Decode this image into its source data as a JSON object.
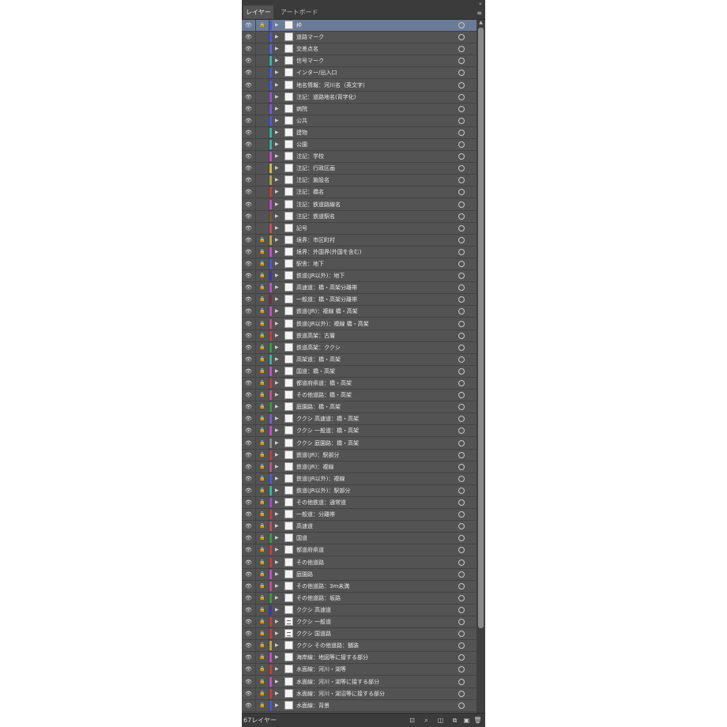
{
  "panel": {
    "tabs": [
      {
        "label": "レイヤー",
        "active": true
      },
      {
        "label": "アートボード",
        "active": false
      }
    ],
    "collapse_icon": "double-chevron-icon",
    "menu_icon": "panel-menu-icon"
  },
  "colors": {
    "panel_bg": "#535353",
    "selected_row": "#6b7a96",
    "tab_bar": "#3b3b3b"
  },
  "layers": [
    {
      "name": "枠",
      "color": "#4a5ad8",
      "locked": true,
      "selected": true
    },
    {
      "name": "道路マーク",
      "color": "#4a5ad8",
      "locked": false
    },
    {
      "name": "交差点名",
      "color": "#5566d8",
      "locked": false
    },
    {
      "name": "信号マーク",
      "color": "#3bb0a8",
      "locked": false
    },
    {
      "name": "インター/出入口",
      "color": "#4a5ad8",
      "locked": false
    },
    {
      "name": "地名情報：河川名（英文字）",
      "color": "#4a5ad8",
      "locked": false
    },
    {
      "name": "注記：道路地名(背字化)",
      "color": "#9a4fd0",
      "locked": false
    },
    {
      "name": "病院",
      "color": "#7a5ad8",
      "locked": false
    },
    {
      "name": "公共",
      "color": "#4a5ad8",
      "locked": false
    },
    {
      "name": "建物",
      "color": "#3bb0a8",
      "locked": false
    },
    {
      "name": "公園",
      "color": "#3bb0a8",
      "locked": false
    },
    {
      "name": "注記：学校",
      "color": "#c04fc8",
      "locked": false
    },
    {
      "name": "注記：行政区画",
      "color": "#c8c040",
      "locked": false
    },
    {
      "name": "注記：施設名",
      "color": "#b0a050",
      "locked": false
    },
    {
      "name": "注記：橋名",
      "color": "#c04040",
      "locked": false
    },
    {
      "name": "注記：鉄道路線名",
      "color": "#c04fc8",
      "locked": false
    },
    {
      "name": "注記：鉄道駅名",
      "color": "#7a5a30",
      "locked": false
    },
    {
      "name": "記号",
      "color": "#c05060",
      "locked": false
    },
    {
      "name": "境界：市区町村",
      "color": "#c0a040",
      "locked": true
    },
    {
      "name": "境界：外国界(外国を含む)",
      "color": "#c04fc8",
      "locked": true
    },
    {
      "name": "駅舎：地下",
      "color": "#4a5ad8",
      "locked": true
    },
    {
      "name": "鉄道(JR以外)：地下",
      "color": "#3a3ab0",
      "locked": true
    },
    {
      "name": "高速道：橋・高架分離帯",
      "color": "#c04fc8",
      "locked": true
    },
    {
      "name": "一般道：橋・高架分離帯",
      "color": "#7a3040",
      "locked": true
    },
    {
      "name": "鉄道(JR)：複線 橋・高架",
      "color": "#c04fc8",
      "locked": true
    },
    {
      "name": "鉄道(JR以外)：複線 橋・高架",
      "color": "#c05090",
      "locked": true
    },
    {
      "name": "鉄道高架：古層",
      "color": "#c04040",
      "locked": true
    },
    {
      "name": "鉄道高架：ククシ",
      "color": "#3a9a40",
      "locked": true
    },
    {
      "name": "高架道：橋・高架",
      "color": "#3bb0a8",
      "locked": true
    },
    {
      "name": "国道：橋・高架",
      "color": "#c04fc8",
      "locked": true
    },
    {
      "name": "都道府県道：橋・高架",
      "color": "#c04040",
      "locked": true
    },
    {
      "name": "その他道路：橋・高架",
      "color": "#c05090",
      "locked": true
    },
    {
      "name": "庭園路：橋・高架",
      "color": "#3a9a40",
      "locked": true
    },
    {
      "name": "ククシ 高速道：橋・高架",
      "color": "#7a5ad8",
      "locked": true
    },
    {
      "name": "ククシ 一般道：橋・高架",
      "color": "#c04fc8",
      "locked": true
    },
    {
      "name": "ククシ 庭園路：橋・高架",
      "color": "#8a8a8a",
      "locked": true
    },
    {
      "name": "鉄道(JR)：駅部分",
      "color": "#c04040",
      "locked": true
    },
    {
      "name": "鉄道(JR)：複線",
      "color": "#c05090",
      "locked": true
    },
    {
      "name": "鉄道(JR以外)：複線",
      "color": "#4a5ad8",
      "locked": true
    },
    {
      "name": "鉄道(JR以外)：駅部分",
      "color": "#3bb0a8",
      "locked": true
    },
    {
      "name": "その他鉄道：通常道",
      "color": "#9a4fd0",
      "locked": true
    },
    {
      "name": "一般道：分離帯",
      "color": "#c04040",
      "locked": true
    },
    {
      "name": "高速道",
      "color": "#c05060",
      "locked": true
    },
    {
      "name": "国道",
      "color": "#3a9a40",
      "locked": true
    },
    {
      "name": "都道府県道",
      "color": "#c04040",
      "locked": true
    },
    {
      "name": "その他道路",
      "color": "#c04040",
      "locked": true
    },
    {
      "name": "庭園路",
      "color": "#c04fc8",
      "locked": true
    },
    {
      "name": "その他道路：3m未満",
      "color": "#c05090",
      "locked": true
    },
    {
      "name": "その他道路：坂路",
      "color": "#3a9a40",
      "locked": true
    },
    {
      "name": "ククシ 高速道",
      "color": "#3a3ab0",
      "locked": true
    },
    {
      "name": "ククシ 一般道",
      "color": "#c04040",
      "locked": true,
      "art": true
    },
    {
      "name": "ククシ 国道路",
      "color": "#c04040",
      "locked": true,
      "art": true
    },
    {
      "name": "ククシ その他道路：舗装",
      "color": "#c0a040",
      "locked": true
    },
    {
      "name": "海岸線：地図等に接する部分",
      "color": "#c04fc8",
      "locked": true
    },
    {
      "name": "水面線：河川・湖等",
      "color": "#c04040",
      "locked": true
    },
    {
      "name": "水面線：河川・湖等に接する部分",
      "color": "#c04fc8",
      "locked": true
    },
    {
      "name": "水面線：河川・湖沼等に接する部分",
      "color": "#c04040",
      "locked": true
    },
    {
      "name": "水面線：背景",
      "color": "#4a5ad8",
      "locked": true
    }
  ],
  "footer": {
    "layer_count": "67レイヤー",
    "icons": [
      "export-icon",
      "locate-icon",
      "make-clip-icon",
      "new-sublayer-icon",
      "new-layer-icon",
      "trash-icon"
    ]
  }
}
